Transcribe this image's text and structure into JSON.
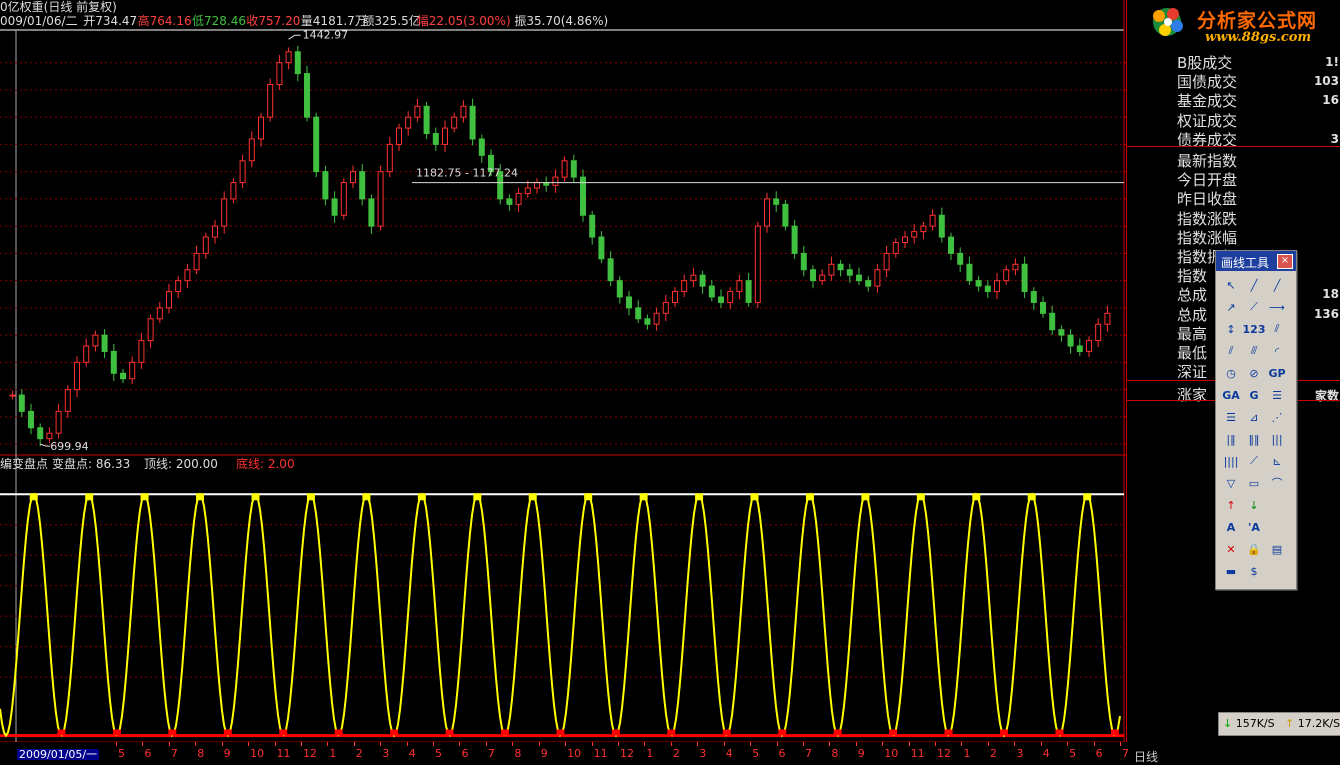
{
  "header": {
    "title": "0亿权重(日线 前复权)",
    "info": [
      {
        "text": "009/01/06/二",
        "color": "#dddddd"
      },
      {
        "text": "开734.47",
        "color": "#dddddd"
      },
      {
        "text": "高764.16",
        "color": "#ff4040"
      },
      {
        "text": "低728.46",
        "color": "#40c040"
      },
      {
        "text": "收757.20",
        "color": "#ff4040"
      },
      {
        "text": "量4181.7万",
        "color": "#dddddd"
      },
      {
        "text": "额325.5亿",
        "color": "#dddddd"
      },
      {
        "text": "幅22.05(3.00%)",
        "color": "#ff4040"
      },
      {
        "text": "振35.70(4.86%)",
        "color": "#dddddd"
      }
    ]
  },
  "annotations": {
    "high_label": "1442.97",
    "low_label": "699.94",
    "hline_label": "1182.75 - 1177.24"
  },
  "indicator": {
    "title": "编变盘点",
    "items": [
      {
        "text": "变盘点: 86.33",
        "color": "#dddddd"
      },
      {
        "text": "顶线: 200.00",
        "color": "#dddddd"
      },
      {
        "text": "底线: 2.00",
        "color": "#ff3030"
      }
    ]
  },
  "right_panel": {
    "logo_text": "分析家公式网",
    "logo_url": "www.88gs.com",
    "items": [
      {
        "label": "B股成交",
        "value": "1!"
      },
      {
        "label": "国债成交",
        "value": "103"
      },
      {
        "label": "基金成交",
        "value": "16"
      },
      {
        "label": "权证成交",
        "value": ""
      },
      {
        "label": "债券成交",
        "value": "3"
      },
      {
        "label": "最新指数",
        "value": ""
      },
      {
        "label": "今日开盘",
        "value": ""
      },
      {
        "label": "昨日收盘",
        "value": ""
      },
      {
        "label": "指数涨跌",
        "value": ""
      },
      {
        "label": "指数涨幅",
        "value": ""
      },
      {
        "label": "指数振幅",
        "value": ""
      },
      {
        "label": "指数",
        "value": ""
      },
      {
        "label": "总成",
        "value": "18"
      },
      {
        "label": "总成",
        "value": "136"
      },
      {
        "label": "最高",
        "value": ""
      },
      {
        "label": "最低",
        "value": ""
      },
      {
        "label": "深证",
        "value": ""
      },
      {
        "label": "涨家",
        "value": "家数"
      }
    ]
  },
  "toolbox": {
    "title": "画线工具",
    "close_symbol": "×",
    "tools": [
      "pointer-tool",
      "line-tool",
      "ray-tool",
      "arrow-line-tool",
      "extend-line-tool",
      "horizontal-ray-tool",
      "vertical-line-tool",
      "price-label-tool",
      "parallel-lines-tool",
      "parallel-channel-tool",
      "trend-channel-tool",
      "arc-tool",
      "circle-tool",
      "spiral-tool",
      "gann-price-tool",
      "gann-angle-tool",
      "gann-fan-tool",
      "fibonacci-retracement-tool",
      "fibonacci-levels-tool",
      "speed-resistance-tool",
      "fan-lines-tool",
      "period-lines-tool",
      "time-zone-tool",
      "equal-lines-tool",
      "cycle-lines-tool",
      "fibonacci-fan-tool",
      "angle-fan-tool",
      "triangle-tool",
      "rectangle-tool",
      "measure-tool",
      "up-arrow-tool",
      "down-arrow-tool",
      "text-tool",
      "text-label-tool",
      "delete-tool",
      "lock-tool",
      "list-tool",
      "ruler-tool",
      "dollar-tool"
    ],
    "tool_labels": {
      "price-label-tool": "123",
      "gann-price-tool": "GP",
      "gann-angle-tool": "GA",
      "gann-fan-tool": "G",
      "text-tool": "A",
      "text-label-tool": "'A"
    }
  },
  "status": {
    "down_speed": "157K/S",
    "up_speed": "17.2K/S"
  },
  "bottom": {
    "date_label": "2009/01/05/一",
    "period_label": "日线",
    "months": [
      "5",
      "6",
      "7",
      "8",
      "9",
      "10",
      "11",
      "12",
      "1",
      "2",
      "3",
      "4",
      "5",
      "6",
      "7",
      "8",
      "9",
      "10",
      "11",
      "12",
      "1",
      "2",
      "3",
      "4",
      "5",
      "6",
      "7",
      "8",
      "9",
      "10",
      "11",
      "12",
      "1",
      "2",
      "3",
      "4",
      "5",
      "6",
      "7"
    ]
  },
  "chart_data": [
    {
      "type": "candlestick",
      "title": "0亿权重(日线 前复权)",
      "ylim": [
        680,
        1460
      ],
      "y_ticks": [
        700,
        750,
        800,
        850,
        900,
        950,
        1000,
        1050,
        1100,
        1150,
        1200,
        1250,
        1300,
        1350,
        1400
      ],
      "grid": true,
      "highest": {
        "value": 1442.97
      },
      "lowest": {
        "value": 699.94
      },
      "horizontal_line": {
        "value": 1180
      },
      "x": [
        "t0",
        "t1",
        "t2",
        "t3",
        "t4",
        "t5",
        "t6",
        "t7",
        "t8",
        "t9",
        "t10",
        "t11",
        "t12",
        "t13",
        "t14",
        "t15",
        "t16",
        "t17",
        "t18",
        "t19",
        "t20",
        "t21",
        "t22",
        "t23",
        "t24",
        "t25",
        "t26",
        "t27",
        "t28",
        "t29",
        "t30",
        "t31",
        "t32",
        "t33",
        "t34",
        "t35",
        "t36",
        "t37",
        "t38",
        "t39",
        "t40",
        "t41",
        "t42",
        "t43",
        "t44",
        "t45",
        "t46",
        "t47",
        "t48",
        "t49",
        "t50",
        "t51",
        "t52",
        "t53",
        "t54",
        "t55",
        "t56",
        "t57",
        "t58",
        "t59",
        "t60",
        "t61",
        "t62",
        "t63",
        "t64",
        "t65",
        "t66",
        "t67",
        "t68",
        "t69",
        "t70",
        "t71",
        "t72",
        "t73",
        "t74",
        "t75",
        "t76",
        "t77",
        "t78",
        "t79",
        "t80",
        "t81",
        "t82",
        "t83",
        "t84",
        "t85",
        "t86",
        "t87",
        "t88",
        "t89",
        "t90",
        "t91",
        "t92",
        "t93",
        "t94",
        "t95",
        "t96",
        "t97",
        "t98",
        "t99",
        "t100",
        "t101",
        "t102",
        "t103",
        "t104",
        "t105",
        "t106",
        "t107",
        "t108",
        "t109",
        "t110",
        "t111",
        "t112",
        "t113",
        "t114",
        "t115",
        "t116",
        "t117",
        "t118",
        "t119"
      ],
      "close": [
        790,
        760,
        730,
        710,
        720,
        760,
        800,
        850,
        880,
        900,
        870,
        830,
        820,
        850,
        890,
        930,
        950,
        980,
        1000,
        1020,
        1050,
        1080,
        1100,
        1150,
        1180,
        1220,
        1260,
        1300,
        1360,
        1400,
        1420,
        1380,
        1300,
        1200,
        1150,
        1120,
        1180,
        1200,
        1150,
        1100,
        1200,
        1250,
        1280,
        1300,
        1320,
        1270,
        1250,
        1280,
        1300,
        1320,
        1260,
        1230,
        1200,
        1150,
        1140,
        1160,
        1170,
        1180,
        1175,
        1190,
        1220,
        1190,
        1120,
        1080,
        1040,
        1000,
        970,
        950,
        930,
        920,
        940,
        960,
        980,
        1000,
        1010,
        990,
        970,
        960,
        980,
        1000,
        960,
        1100,
        1150,
        1140,
        1100,
        1050,
        1020,
        1000,
        1010,
        1030,
        1020,
        1010,
        1000,
        990,
        1020,
        1050,
        1070,
        1080,
        1090,
        1100,
        1120,
        1080,
        1050,
        1030,
        1000,
        990,
        980,
        1000,
        1020,
        1030,
        980,
        960,
        940,
        910,
        900,
        880,
        870,
        890,
        920,
        940
      ],
      "series": []
    },
    {
      "type": "line",
      "title": "编变盘点",
      "ylim": [
        0,
        215
      ],
      "y_ticks": [
        50,
        75,
        100,
        125,
        150,
        175,
        200
      ],
      "top_line": 200.0,
      "bottom_line": 2.0,
      "current_value": 86.33,
      "cycles": 20,
      "series": [
        {
          "name": "变盘点",
          "color": "#ffff00"
        }
      ]
    }
  ]
}
